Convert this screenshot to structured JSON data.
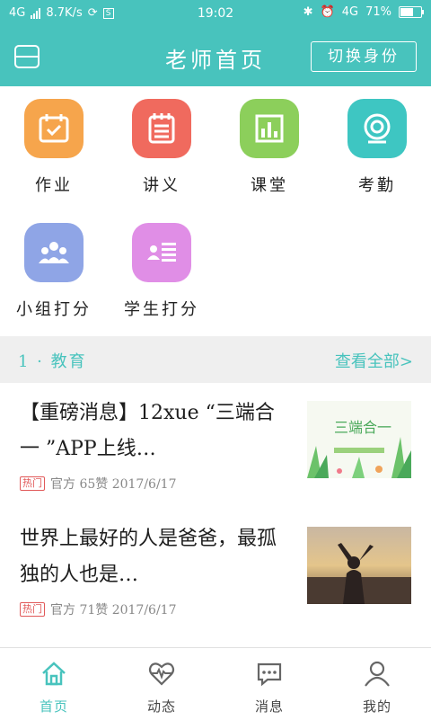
{
  "status": {
    "network": "4G",
    "speed": "8.7K/s",
    "time": "19:02",
    "net2": "4G",
    "battery": "71%",
    "battery_level": 0.71
  },
  "header": {
    "title": "老师首页",
    "switch_label": "切换身份"
  },
  "grid": [
    {
      "label": "作业",
      "icon": "calendar-check-icon",
      "color": "#f6a54c"
    },
    {
      "label": "讲义",
      "icon": "notepad-icon",
      "color": "#f06a5e"
    },
    {
      "label": "课堂",
      "icon": "bar-chart-icon",
      "color": "#8ccf5b"
    },
    {
      "label": "考勤",
      "icon": "camera-icon",
      "color": "#3ec6c2"
    },
    {
      "label": "小组打分",
      "icon": "group-icon",
      "color": "#8fa5e6"
    },
    {
      "label": "学生打分",
      "icon": "id-card-icon",
      "color": "#e08ee6"
    }
  ],
  "section": {
    "title": "1 · 教育",
    "more": "查看全部>"
  },
  "news": [
    {
      "title": "【重磅消息】12xue “三端合一 ”APP上线…",
      "tag": "热门",
      "meta": "官方 65赞 2017/6/17",
      "thumb_text": "三端合一"
    },
    {
      "title": "世界上最好的人是爸爸，最孤独的人也是…",
      "tag": "热门",
      "meta": "官方 71赞 2017/6/17"
    }
  ],
  "tabs": [
    {
      "label": "首页",
      "icon": "home-icon",
      "active": true
    },
    {
      "label": "动态",
      "icon": "heartbeat-icon"
    },
    {
      "label": "消息",
      "icon": "chat-bubble-icon"
    },
    {
      "label": "我的",
      "icon": "user-icon"
    }
  ],
  "colors": {
    "primary": "#48c3bd",
    "tag": "#e15a5a"
  }
}
